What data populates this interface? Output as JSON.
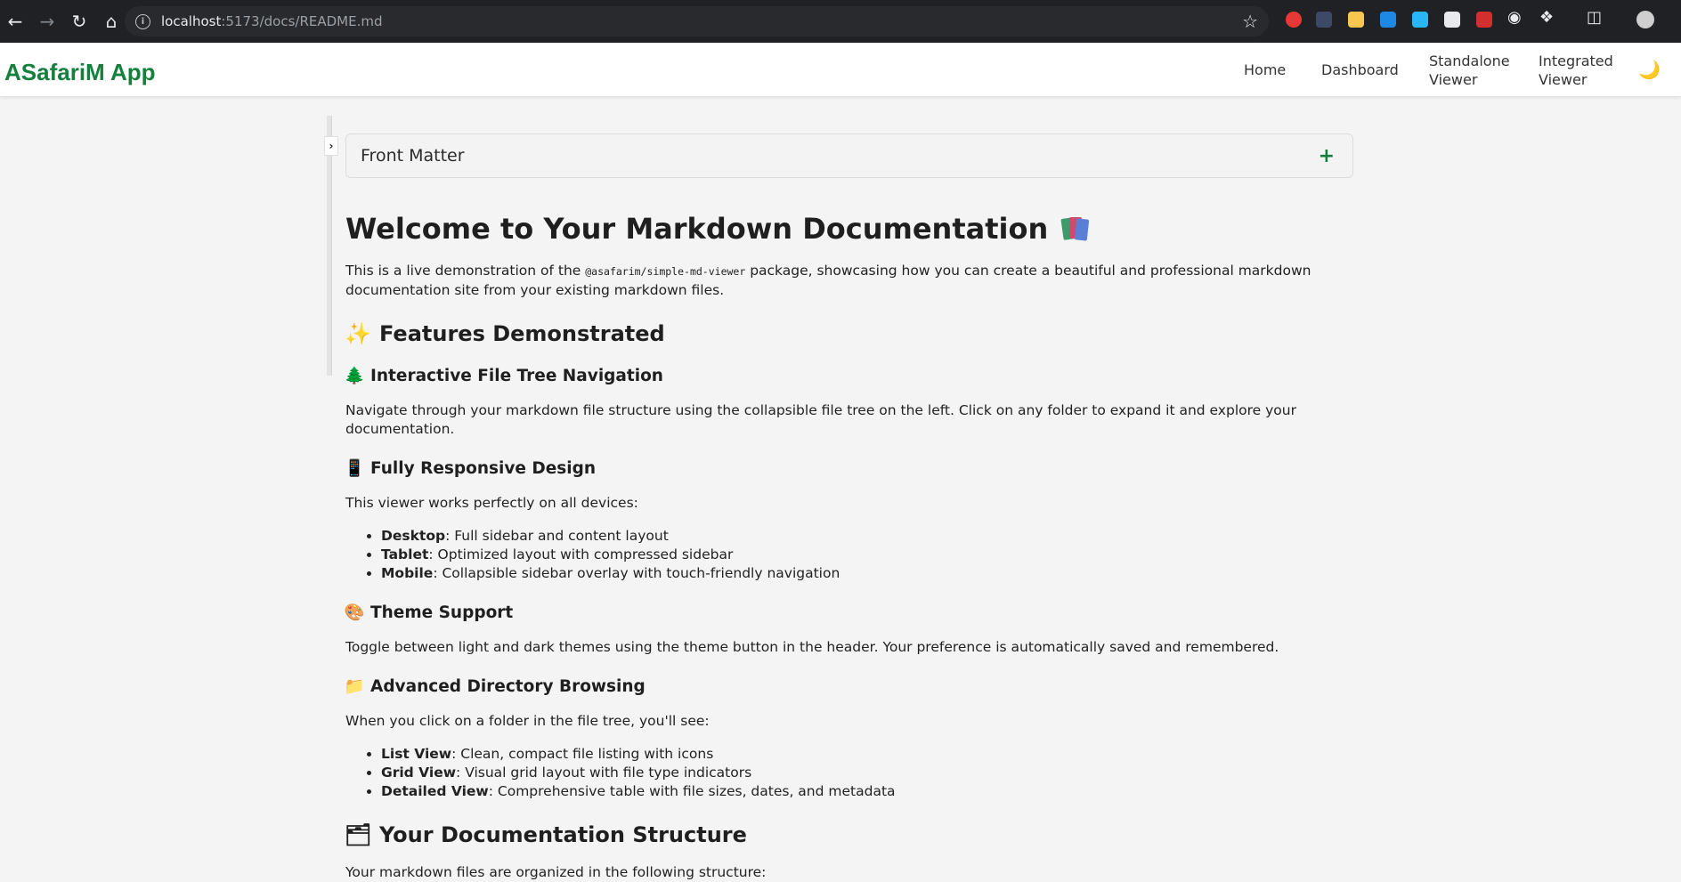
{
  "browser": {
    "url_host": "localhost",
    "url_path": ":5173/docs/README.md"
  },
  "header": {
    "brand": "ASafariM App",
    "nav": [
      {
        "line1": "Home",
        "line2": ""
      },
      {
        "line1": "Dashboard",
        "line2": ""
      },
      {
        "line1": "Standalone",
        "line2": "Viewer"
      },
      {
        "line1": "Integrated",
        "line2": "Viewer"
      }
    ],
    "theme_icon": "moon-icon"
  },
  "sidebar": {
    "toggle_icon": "chevron-right-icon",
    "toggle_glyph": "›"
  },
  "front_matter": {
    "title": "Front Matter",
    "toggle": "+"
  },
  "doc": {
    "title": "Welcome to Your Markdown Documentation",
    "intro_before": "This is a live demonstration of the ",
    "intro_code": "@asafarim/simple-md-viewer",
    "intro_after": " package, showcasing how you can create a beautiful and professional markdown documentation site from your existing markdown files.",
    "features_heading": "Features Demonstrated",
    "features_emoji": "✨",
    "nav_heading": "Interactive File Tree Navigation",
    "nav_emoji": "🌲",
    "nav_text": "Navigate through your markdown file structure using the collapsible file tree on the left. Click on any folder to expand it and explore your documentation.",
    "responsive_heading": "Fully Responsive Design",
    "responsive_emoji": "📱",
    "responsive_text": "This viewer works perfectly on all devices:",
    "responsive_items": [
      {
        "term": "Desktop",
        "desc": ": Full sidebar and content layout"
      },
      {
        "term": "Tablet",
        "desc": ": Optimized layout with compressed sidebar"
      },
      {
        "term": "Mobile",
        "desc": ": Collapsible sidebar overlay with touch-friendly navigation"
      }
    ],
    "theme_heading": "Theme Support",
    "theme_emoji": "🎨",
    "theme_text": "Toggle between light and dark themes using the theme button in the header. Your preference is automatically saved and remembered.",
    "dir_heading": "Advanced Directory Browsing",
    "dir_emoji": "📁",
    "dir_text": "When you click on a folder in the file tree, you'll see:",
    "dir_items": [
      {
        "term": "List View",
        "desc": ": Clean, compact file listing with icons"
      },
      {
        "term": "Grid View",
        "desc": ": Visual grid layout with file type indicators"
      },
      {
        "term": "Detailed View",
        "desc": ": Comprehensive table with file sizes, dates, and metadata"
      }
    ],
    "structure_heading": "Your Documentation Structure",
    "structure_emoji": "🗂",
    "structure_text": "Your markdown files are organized in the following structure:"
  },
  "colors": {
    "brand": "#15803d",
    "browser_bg": "#202124",
    "page_bg": "#f4f4f4"
  }
}
